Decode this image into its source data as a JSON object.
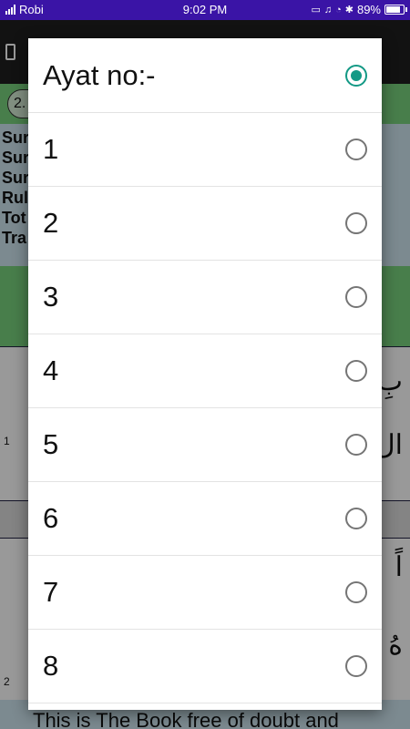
{
  "status_bar": {
    "carrier": "Robi",
    "time": "9:02 PM",
    "battery": "89%",
    "battery_level": 0.89
  },
  "background": {
    "selector_value": "2.",
    "info_lines": [
      "Sur",
      "Sur",
      "Sur",
      "Rul",
      "Tot",
      "Tra"
    ],
    "row_numbers": [
      "1",
      "2"
    ],
    "arabic_fragments": [
      "بِ",
      "ال",
      "اً",
      "هُ"
    ],
    "translation_fragment": "This is The Book free of doubt and"
  },
  "dialog": {
    "title": "Ayat no:-",
    "title_selected": true,
    "options": [
      {
        "label": "1",
        "selected": false
      },
      {
        "label": "2",
        "selected": false
      },
      {
        "label": "3",
        "selected": false
      },
      {
        "label": "4",
        "selected": false
      },
      {
        "label": "5",
        "selected": false
      },
      {
        "label": "6",
        "selected": false
      },
      {
        "label": "7",
        "selected": false
      },
      {
        "label": "8",
        "selected": false
      }
    ]
  },
  "colors": {
    "status_bar": "#3a14a6",
    "accent_green": "#79d27d",
    "radio_checked": "#139985"
  }
}
